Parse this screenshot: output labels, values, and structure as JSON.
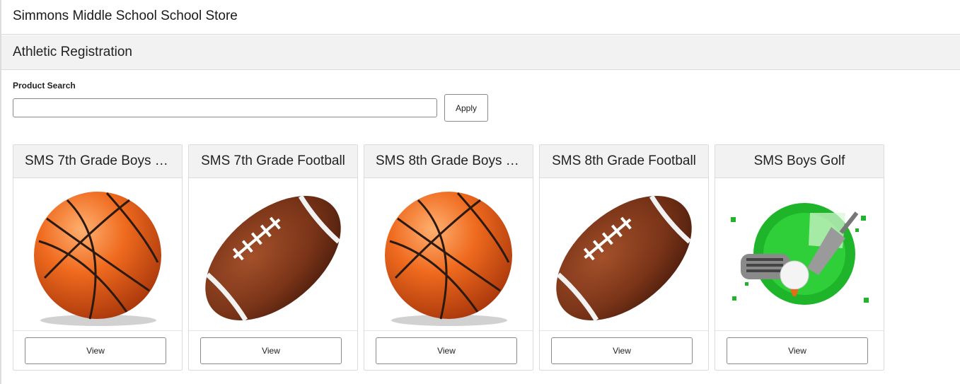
{
  "header": {
    "store_title": "Simmons Middle School School Store"
  },
  "section": {
    "title": "Athletic Registration"
  },
  "search": {
    "label": "Product Search",
    "value": "",
    "placeholder": "",
    "apply_label": "Apply"
  },
  "products": [
    {
      "name": "SMS 7th Grade Boys B...",
      "image": "basketball-image",
      "view_label": "View"
    },
    {
      "name": "SMS 7th Grade Football",
      "image": "football-image",
      "view_label": "View"
    },
    {
      "name": "SMS 8th Grade Boys B...",
      "image": "basketball-image",
      "view_label": "View"
    },
    {
      "name": "SMS 8th Grade Football",
      "image": "football-image",
      "view_label": "View"
    },
    {
      "name": "SMS Boys Golf",
      "image": "golf-image",
      "view_label": "View"
    }
  ],
  "colors": {
    "header_bg": "#f2f2f2",
    "basketball": "#e8601c",
    "football": "#7a3418",
    "golf_green": "#1fb52a"
  }
}
